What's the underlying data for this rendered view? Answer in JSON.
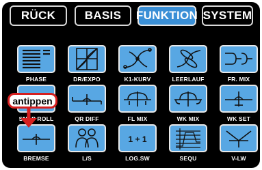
{
  "tabs": [
    {
      "label": "RÜCK",
      "active": false
    },
    {
      "label": "BASIS",
      "active": false
    },
    {
      "label": "FUNKTION",
      "active": true
    },
    {
      "label": "SYSTEM",
      "active": false
    }
  ],
  "tiles": [
    {
      "label": "PHASE",
      "icon": "phase-icon"
    },
    {
      "label": "DR/EXPO",
      "icon": "dr-expo-icon"
    },
    {
      "label": "K1-KURV",
      "icon": "k1-curve-icon"
    },
    {
      "label": "LEERLAUF",
      "icon": "leerlauf-icon"
    },
    {
      "label": "FR. MIX",
      "icon": "free-mix-icon"
    },
    {
      "label": "SNAP ROLL",
      "icon": "snap-roll-icon"
    },
    {
      "label": "QR DIFF",
      "icon": "aileron-diff-icon"
    },
    {
      "label": "FL MIX",
      "icon": "flap-mix-icon"
    },
    {
      "label": "WK MIX",
      "icon": "wk-mix-icon"
    },
    {
      "label": "WK SET",
      "icon": "wk-set-icon"
    },
    {
      "label": "BREMSE",
      "icon": "brake-icon"
    },
    {
      "label": "L/S",
      "icon": "trainer-icon"
    },
    {
      "label": "LOG.SW",
      "icon": "logic-switch-icon"
    },
    {
      "label": "SEQU",
      "icon": "sequencer-icon"
    },
    {
      "label": "V-LW",
      "icon": "v-tail-icon"
    }
  ],
  "callout": {
    "text": "antippen",
    "color": "#d62020"
  },
  "colors": {
    "accent": "#3a8fd6",
    "tile": "#58a7e3",
    "background": "#000000"
  }
}
